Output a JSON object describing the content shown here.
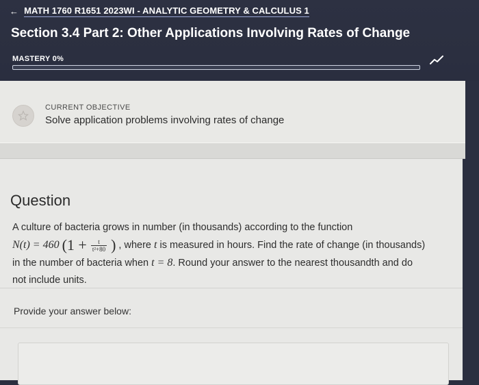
{
  "header": {
    "back_arrow": "←",
    "course_title": "MATH 1760 R1651 2023WI - ANALYTIC GEOMETRY & CALCULUS 1",
    "section_title": "Section 3.4 Part 2: Other Applications Involving Rates of Change",
    "mastery_label": "MASTERY 0%",
    "mastery_percent": 0,
    "trend_icon": "trend-line-icon",
    "accent_color": "#3b82f6"
  },
  "objective": {
    "icon": "star-icon",
    "label": "CURRENT OBJECTIVE",
    "text": "Solve application problems involving rates of change"
  },
  "question": {
    "heading": "Question",
    "intro": "A culture of bacteria grows in number (in thousands) according to the function",
    "formula_lhs": "N(t) = 460",
    "formula_open": "(1 +",
    "frac_num": "t",
    "frac_den": "t²+80",
    "formula_close": ")",
    "after_formula": ", where",
    "var_t": "t",
    "rest_line1": "is measured in hours. Find the rate of change (in thousands)",
    "line2_start": "in the number of bacteria when",
    "t_value": "t = 8",
    "line2_end": ". Round your answer to the nearest thousandth and do",
    "line3": "not include units.",
    "answer_prompt": "Provide your answer below:"
  }
}
